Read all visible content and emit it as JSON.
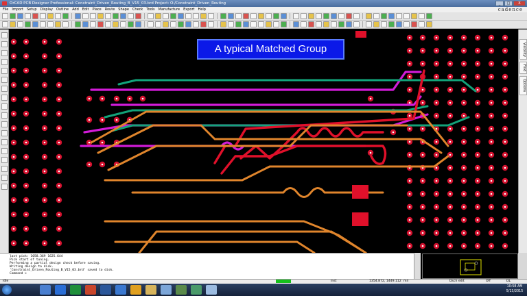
{
  "window": {
    "title": "OrCAD PCB Designer Professional: Constraint_Driven_Routing_B_V15_03.brd  Project: O:/Constraint_Driven_Routing",
    "min": "_",
    "max": "□",
    "close": "X"
  },
  "brand": "cadence",
  "menu": [
    "File",
    "Import",
    "Setup",
    "Display",
    "Outline",
    "Add",
    "Edit",
    "Place",
    "Route",
    "Shape",
    "Check",
    "Tools",
    "Manufacture",
    "Export",
    "Help"
  ],
  "right_tabs": [
    "Visibility",
    "Find",
    "Options"
  ],
  "callout": "A typical Matched Group",
  "console": {
    "lines": [
      "last pick:  1058.369 1625.644",
      "Pick start of tuning.",
      "Performing a partial design check before saving.",
      "Writing design to disk.",
      "'Constraint_Driven_Routing_B_V15_03.brd' saved to disk.",
      "Command >"
    ]
  },
  "status": {
    "mode": "Idle",
    "grid": "Inst",
    "coords": "1354.872, 1449.112",
    "units": "mil",
    "sub": "Dsch edit",
    "off": "Off",
    "dl": "DL"
  },
  "clock": {
    "time": "10:58 AM",
    "date": "5/13/2015"
  },
  "colors": {
    "magenta": "#d21bd8",
    "green": "#12a37a",
    "orange": "#e0852c",
    "red": "#e0102a",
    "pad": "#d3112e",
    "callout": "#0b19e8"
  },
  "toolbar_icons": [
    "new-icon",
    "open-icon",
    "save-icon",
    "undo-icon",
    "redo-icon",
    "zoom-in-icon",
    "zoom-out-icon",
    "zoom-fit-icon",
    "grid-icon",
    "route-icon",
    "slide-icon",
    "delay-tune-icon",
    "3d-view-icon"
  ]
}
